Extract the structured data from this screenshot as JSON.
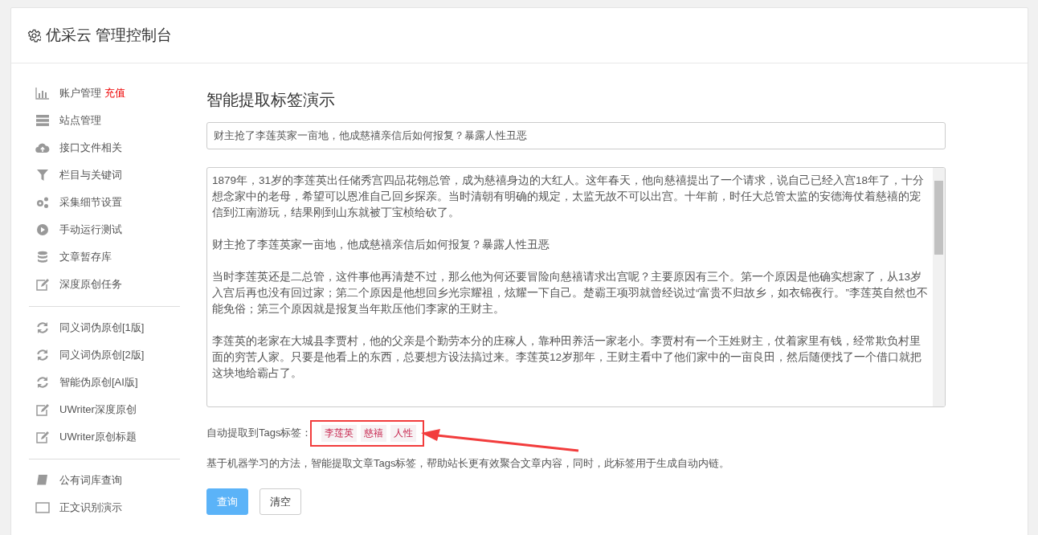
{
  "header": {
    "title": "优采云 管理控制台"
  },
  "sidebar": {
    "groups": [
      [
        {
          "kind": "chart",
          "label": "账户管理",
          "badge": "充值"
        },
        {
          "kind": "server",
          "label": "站点管理"
        },
        {
          "kind": "upload",
          "label": "接口文件相关"
        },
        {
          "kind": "filter",
          "label": "栏目与关键词"
        },
        {
          "kind": "gears",
          "label": "采集细节设置"
        },
        {
          "kind": "play",
          "label": "手动运行测试"
        },
        {
          "kind": "database",
          "label": "文章暂存库"
        },
        {
          "kind": "edit",
          "label": "深度原创任务"
        }
      ],
      [
        {
          "kind": "refresh",
          "label": "同义词伪原创[1版]"
        },
        {
          "kind": "refresh",
          "label": "同义词伪原创[2版]"
        },
        {
          "kind": "refresh",
          "label": "智能伪原创[AI版]"
        },
        {
          "kind": "edit",
          "label": "UWriter深度原创"
        },
        {
          "kind": "edit",
          "label": "UWriter原创标题"
        }
      ],
      [
        {
          "kind": "book",
          "label": "公有词库查询"
        },
        {
          "kind": "window",
          "label": "正文识别演示"
        }
      ]
    ]
  },
  "main": {
    "title": "智能提取标签演示",
    "title_field": {
      "value": "财主抢了李莲英家一亩地，他成慈禧亲信后如何报复？暴露人性丑恶"
    },
    "content_paragraphs": [
      "1879年，31岁的李莲英出任储秀宫四品花翎总管，成为慈禧身边的大红人。这年春天，他向慈禧提出了一个请求，说自己已经入宫18年了，十分想念家中的老母，希望可以恩准自己回乡探亲。当时清朝有明确的规定，太监无故不可以出宫。十年前，时任大总管太监的安德海仗着慈禧的宠信到江南游玩，结果刚到山东就被丁宝桢给砍了。",
      "财主抢了李莲英家一亩地，他成慈禧亲信后如何报复？暴露人性丑恶",
      "当时李莲英还是二总管，这件事他再清楚不过，那么他为何还要冒险向慈禧请求出宫呢？主要原因有三个。第一个原因是他确实想家了，从13岁入宫后再也没有回过家；第二个原因是他想回乡光宗耀祖，炫耀一下自己。楚霸王项羽就曾经说过“富贵不归故乡，如衣锦夜行。”李莲英自然也不能免俗；第三个原因就是报复当年欺压他们李家的王财主。",
      "李莲英的老家在大城县李贾村，他的父亲是个勤劳本分的庄稼人，靠种田养活一家老小。李贾村有一个王姓财主，仗着家里有钱，经常欺负村里面的穷苦人家。只要是他看上的东西，总要想方设法搞过来。李莲英12岁那年，王财主看中了他们家中的一亩良田，然后随便找了一个借口就把这块地给霸占了。"
    ],
    "tags_label": "自动提取到Tags标签：",
    "tags": [
      "李莲英",
      "慈禧",
      "人性"
    ],
    "description": "基于机器学习的方法，智能提取文章Tags标签，帮助站长更有效聚合文章内容，同时，此标签用于生成自动内链。",
    "buttons": [
      {
        "kind": "primary",
        "label": "查询"
      },
      {
        "kind": "default",
        "label": "清空"
      }
    ]
  }
}
